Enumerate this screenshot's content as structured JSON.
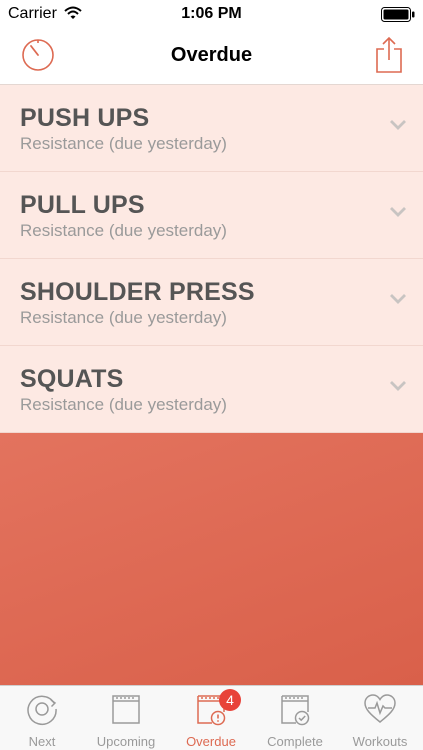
{
  "status": {
    "carrier": "Carrier",
    "time": "1:06 PM"
  },
  "nav": {
    "title": "Overdue",
    "left_icon": "timer-icon",
    "right_icon": "share-icon"
  },
  "items": [
    {
      "title": "PUSH UPS",
      "subtitle": "Resistance (due yesterday)"
    },
    {
      "title": "PULL UPS",
      "subtitle": "Resistance (due yesterday)"
    },
    {
      "title": "SHOULDER PRESS",
      "subtitle": "Resistance (due yesterday)"
    },
    {
      "title": "SQUATS",
      "subtitle": "Resistance (due yesterday)"
    }
  ],
  "tabs": [
    {
      "label": "Next",
      "icon": "next-icon"
    },
    {
      "label": "Upcoming",
      "icon": "calendar-icon"
    },
    {
      "label": "Overdue",
      "icon": "calendar-alert-icon",
      "badge": "4",
      "active": true
    },
    {
      "label": "Complete",
      "icon": "calendar-check-icon"
    },
    {
      "label": "Workouts",
      "icon": "heart-pulse-icon"
    }
  ],
  "colors": {
    "accent": "#dd6a52",
    "list_background": "#fde9e3",
    "empty_area": "#dd6a52",
    "badge": "#e8433a"
  }
}
